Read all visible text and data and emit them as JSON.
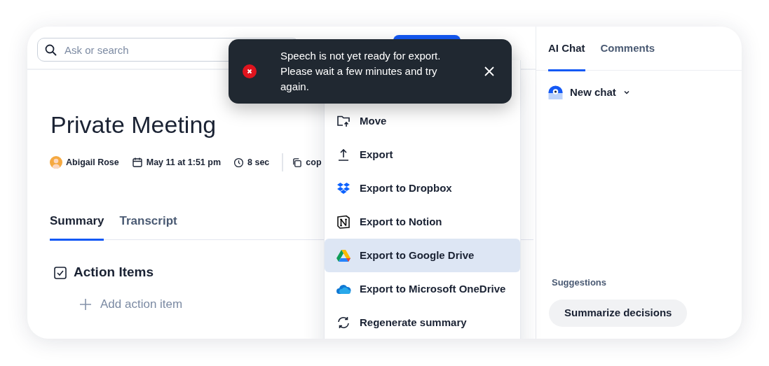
{
  "search": {
    "placeholder": "Ask or search"
  },
  "toast": {
    "kind": "error",
    "message": "Speech is not yet ready for export. Please wait a few minutes and try again."
  },
  "meeting": {
    "title": "Private Meeting",
    "owner": "Abigail Rose",
    "date": "May 11 at 1:51 pm",
    "duration": "8 sec",
    "copy_label": "cop"
  },
  "tabs": [
    {
      "label": "Summary",
      "selected": true
    },
    {
      "label": "Transcript",
      "selected": false
    }
  ],
  "action_items": {
    "heading": "Action Items",
    "add_label": "Add action item"
  },
  "menu": [
    {
      "label": "Move",
      "kind": "move",
      "selected": false
    },
    {
      "label": "Export",
      "kind": "export",
      "selected": false
    },
    {
      "label": "Export to Dropbox",
      "kind": "dropbox",
      "selected": false
    },
    {
      "label": "Export to Notion",
      "kind": "notion",
      "selected": false
    },
    {
      "label": "Export to Google Drive",
      "kind": "gdrive",
      "selected": true
    },
    {
      "label": "Export to Microsoft OneDrive",
      "kind": "onedrive",
      "selected": false
    },
    {
      "label": "Regenerate summary",
      "kind": "regenerate",
      "selected": false
    }
  ],
  "side_tabs": [
    {
      "label": "AI Chat",
      "selected": true
    },
    {
      "label": "Comments",
      "selected": false
    }
  ],
  "chat": {
    "title": "New chat"
  },
  "suggestions": {
    "heading": "Suggestions",
    "items": [
      "Summarize decisions"
    ]
  }
}
